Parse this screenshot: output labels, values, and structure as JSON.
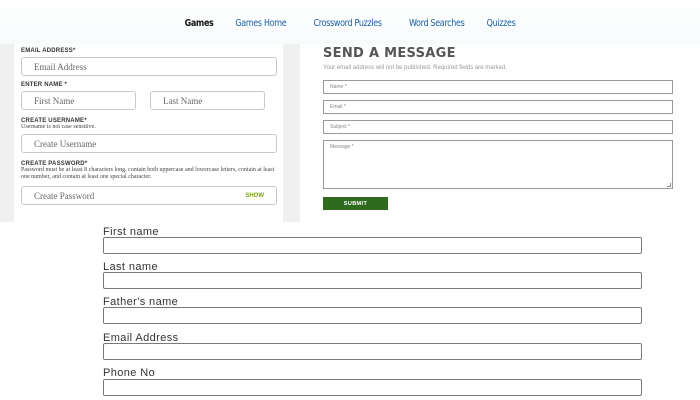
{
  "nav": {
    "items": [
      {
        "label": "Games",
        "active": true
      },
      {
        "label": "Games Home",
        "active": false
      },
      {
        "label": "Crossword Puzzles",
        "active": false
      },
      {
        "label": "Word Searches",
        "active": false
      },
      {
        "label": "Quizzes",
        "active": false
      }
    ]
  },
  "signup": {
    "email_label": "EMAIL ADDRESS*",
    "email_placeholder": "Email Address",
    "name_label": "ENTER NAME *",
    "first_placeholder": "First Name",
    "last_placeholder": "Last Name",
    "username_label": "CREATE USERNAME*",
    "username_note": "Username is not case sensitive.",
    "username_placeholder": "Create Username",
    "password_label": "CREATE PASSWORD*",
    "password_note": "Password must be at least 8 characters long, contain both uppercase and lowercase letters, contain at least one number, and contain at least one special character.",
    "password_placeholder": "Create Password",
    "show_label": "SHOW",
    "show_color": "#7aa21d"
  },
  "contact": {
    "title": "SEND A MESSAGE",
    "note": "Your email address will not be published. Required fields are marked.",
    "name_placeholder": "Name *",
    "email_placeholder": "Email *",
    "subject_placeholder": "Subject *",
    "message_placeholder": "Message *",
    "submit_label": "SUBMIT",
    "submit_color": "#2e6b1e"
  },
  "bottom_form": {
    "fields": [
      {
        "label": "First name"
      },
      {
        "label": "Last name"
      },
      {
        "label": "Father's name"
      },
      {
        "label": "Email Address"
      },
      {
        "label": "Phone No"
      }
    ]
  }
}
